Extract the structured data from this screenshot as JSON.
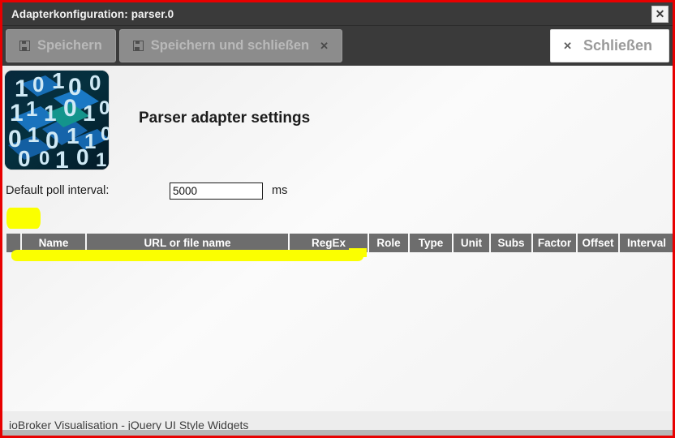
{
  "window": {
    "title": "Adapterkonfiguration: parser.0",
    "close_icon": "close-icon",
    "close_label": "✕"
  },
  "toolbar": {
    "save_label": "Speichern",
    "save_icon": "floppy-disk-icon",
    "save_close_label": "Speichern und schließen",
    "save_close_icon": "floppy-disk-icon",
    "save_close_x": "✕",
    "close_label": "Schließen",
    "close_x": "✕"
  },
  "main": {
    "adapter_icon": "binary-code-cubes-icon",
    "settings_title": "Parser adapter settings",
    "poll": {
      "label": "Default poll interval:",
      "value": "5000",
      "placeholder": "",
      "unit": "ms"
    },
    "select_all": {
      "name": "select-all-checkbox",
      "checked": true
    },
    "table": {
      "columns": [
        "",
        "Name",
        "URL or file name",
        "RegEx",
        "Role",
        "Type",
        "Unit",
        "Subs",
        "Factor",
        "Offset",
        "Interval",
        ""
      ],
      "rows": []
    }
  },
  "footer": {
    "bleed_text": "ioBroker Visualisation - jQuery UI Style Widgets"
  },
  "annotations": {
    "highlight_color": "#fbff00",
    "frame_color": "#e80000",
    "marks": [
      "select-all-checkbox-highlight",
      "table-header-underline-highlight"
    ]
  },
  "colors": {
    "titlebar_bg": "#3a3a3a",
    "toolbar_bg": "#3a3a3a",
    "button_bg": "#8c8c8c",
    "table_header_bg": "#6d6d6d",
    "content_bg": "#f1f1f1",
    "checkbox_fill": "#c9c900"
  }
}
